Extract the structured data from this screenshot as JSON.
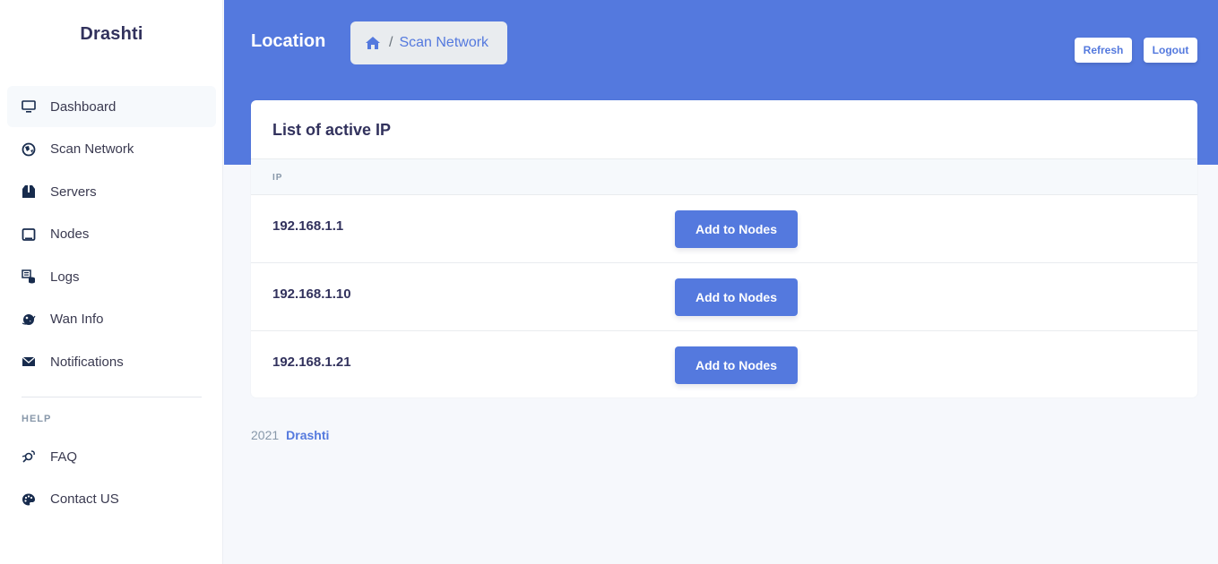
{
  "sidebar": {
    "brand": "Drashti",
    "items": [
      {
        "label": "Dashboard",
        "icon": "monitor-icon"
      },
      {
        "label": "Scan Network",
        "icon": "globe-icon"
      },
      {
        "label": "Servers",
        "icon": "box-icon"
      },
      {
        "label": "Nodes",
        "icon": "tablet-icon"
      },
      {
        "label": "Logs",
        "icon": "logs-icon"
      },
      {
        "label": "Wan Info",
        "icon": "planet-icon"
      },
      {
        "label": "Notifications",
        "icon": "envelope-icon"
      }
    ],
    "help_heading": "HELP",
    "help_items": [
      {
        "label": "FAQ",
        "icon": "satellite-icon"
      },
      {
        "label": "Contact US",
        "icon": "palette-icon"
      }
    ]
  },
  "header": {
    "title": "Location",
    "breadcrumb": {
      "home_icon": "home-icon",
      "separator": "/",
      "current": "Scan Network"
    },
    "refresh_label": "Refresh",
    "logout_label": "Logout"
  },
  "card": {
    "title": "List of active IP",
    "column_header": "IP",
    "rows": [
      {
        "ip": "192.168.1.1",
        "action": "Add to Nodes"
      },
      {
        "ip": "192.168.1.10",
        "action": "Add to Nodes"
      },
      {
        "ip": "192.168.1.21",
        "action": "Add to Nodes"
      }
    ]
  },
  "footer": {
    "year": "2021",
    "link": "Drashti"
  },
  "colors": {
    "accent": "#5479de",
    "sidebar_bg": "#ffffff",
    "page_bg": "#f6f8fc"
  }
}
